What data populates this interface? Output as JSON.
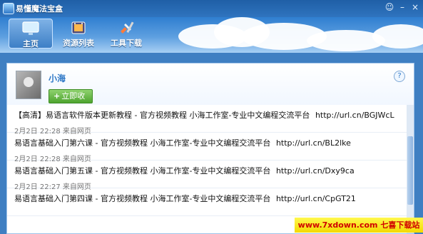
{
  "app": {
    "title": "易懂魔法宝盒"
  },
  "nav": {
    "items": [
      {
        "label": "主页"
      },
      {
        "label": "资源列表"
      },
      {
        "label": "工具下载"
      }
    ]
  },
  "profile": {
    "name": "小海",
    "listen_button": "立即收听"
  },
  "feed": [
    {
      "text": "【高清】易语言软件版本更新教程 - 官方视频教程 小海工作室-专业中文编程交流平台",
      "link": "http://url.cn/BGJWcL",
      "meta": "2月2日 22:28 来自网页"
    },
    {
      "text": "易语言基础入门第六课 - 官方视频教程 小海工作室-专业中文编程交流平台",
      "link": "http://url.cn/BL2lke",
      "meta": "2月2日 22:28 来自网页"
    },
    {
      "text": "易语言基础入门第五课 - 官方视频教程 小海工作室-专业中文编程交流平台",
      "link": "http://url.cn/Dxy9ca",
      "meta": "2月2日 22:27 来自网页"
    },
    {
      "text": "易语言基础入门第四课 - 官方视频教程 小海工作室-专业中文编程交流平台",
      "link": "http://url.cn/CpGT21",
      "meta": ""
    }
  ],
  "watermark": "www.7xdown.com 七喜下载站"
}
